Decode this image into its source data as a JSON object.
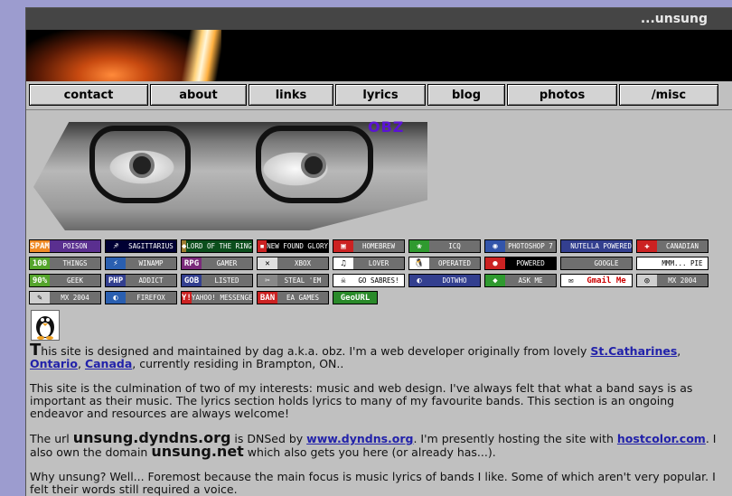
{
  "site": {
    "title": "...unsung"
  },
  "nav": [
    {
      "label": "contact",
      "w": 130
    },
    {
      "label": "about",
      "w": 105
    },
    {
      "label": "links",
      "w": 92
    },
    {
      "label": "lyrics",
      "w": 98
    },
    {
      "label": "blog",
      "w": 84
    },
    {
      "label": "photos",
      "w": 120
    },
    {
      "label": "/misc",
      "w": 108
    }
  ],
  "hero": {
    "tag": "OBZ"
  },
  "buttons": [
    {
      "icon": "SPAM",
      "text": "POISON",
      "bg": "#5a2f8f",
      "ic": "#f08a24"
    },
    {
      "icon": "♐",
      "text": "SAGITTARIUS",
      "bg": "#000033",
      "ic": "#000033"
    },
    {
      "icon": "◆",
      "text": "LORD OF THE RINGS",
      "bg": "#0b4e1c",
      "ic": "#9c7c30"
    },
    {
      "icon": "▪",
      "text": "NEW FOUND GLORY",
      "bg": "#000000",
      "ic": "#cc2222"
    },
    {
      "icon": "▣",
      "text": "HOMEBREW",
      "bg": "#6f6f6f",
      "ic": "#cc2222"
    },
    {
      "icon": "❀",
      "text": "ICQ",
      "bg": "#6f6f6f",
      "ic": "#2f9a2f"
    },
    {
      "icon": "◉",
      "text": "PHOTOSHOP 7",
      "bg": "#6f6f6f",
      "ic": "#3355aa"
    },
    {
      "icon": "",
      "text": "NUTELLA POWERED",
      "bg": "#333f8f",
      "ic": "#333f8f"
    },
    {
      "icon": "✚",
      "text": "CANADIAN",
      "bg": "#6f6f6f",
      "ic": "#cc2222"
    },
    {
      "icon": "100",
      "text": "THINGS",
      "bg": "#6f6f6f",
      "ic": "#55a52c"
    },
    {
      "icon": "⚡",
      "text": "WINAMP",
      "bg": "#6f6f6f",
      "ic": "#2a5fb0"
    },
    {
      "icon": "RPG",
      "text": "GAMER",
      "bg": "#6f6f6f",
      "ic": "#7a2a7a"
    },
    {
      "icon": "✕",
      "text": "XBOX",
      "bg": "#6f6f6f",
      "ic": "#e0e0e0"
    },
    {
      "icon": "♫",
      "text": "LOVER",
      "bg": "#6f6f6f",
      "ic": "#ffffff"
    },
    {
      "icon": "🐧",
      "text": "OPERATED",
      "bg": "#6f6f6f",
      "ic": "#ffffff"
    },
    {
      "icon": "●",
      "text": "POWERED",
      "bg": "#000000",
      "ic": "#cc2222"
    },
    {
      "icon": "",
      "text": "GOOGLE",
      "bg": "#6f6f6f",
      "ic": "#6f6f6f"
    },
    {
      "icon": "",
      "text": "MMM... PIE",
      "bg": "#ffffff",
      "ic": "#ffffff"
    },
    {
      "icon": "90%",
      "text": "GEEK",
      "bg": "#6f6f6f",
      "ic": "#55a52c"
    },
    {
      "icon": "PHP",
      "text": "ADDICT",
      "bg": "#6f6f6f",
      "ic": "#333f8f"
    },
    {
      "icon": "GOB",
      "text": "LISTED",
      "bg": "#6f6f6f",
      "ic": "#333f8f"
    },
    {
      "icon": "✂",
      "text": "STEAL 'EM",
      "bg": "#6f6f6f",
      "ic": "#888888"
    },
    {
      "icon": "☠",
      "text": "GO SABRES!",
      "bg": "#ffffff",
      "ic": "#ffffff"
    },
    {
      "icon": "◐",
      "text": "DOTWHO",
      "bg": "#333f8f",
      "ic": "#333f8f"
    },
    {
      "icon": "◆",
      "text": "ASK ME",
      "bg": "#6f6f6f",
      "ic": "#2f9a2f"
    },
    {
      "icon": "✉",
      "text": "Gmail Me",
      "bg": "#ffffff",
      "ic": "#ffffff"
    },
    {
      "icon": "◎",
      "text": "MX 2004",
      "bg": "#6f6f6f",
      "ic": "#cfcfcf"
    },
    {
      "icon": "✎",
      "text": "MX 2004",
      "bg": "#6f6f6f",
      "ic": "#cfcfcf"
    },
    {
      "icon": "◐",
      "text": "FIREFOX",
      "bg": "#6f6f6f",
      "ic": "#2a5fb0"
    },
    {
      "icon": "Y!",
      "text": "YAHOO! MESSENGER",
      "bg": "#6f6f6f",
      "ic": "#cc2222"
    },
    {
      "icon": "BAN",
      "text": "EA GAMES",
      "bg": "#6f6f6f",
      "ic": "#cc2222"
    },
    {
      "icon": "",
      "text": "GeoURL",
      "bg": "#2a8a2a",
      "ic": "#2a8a2a"
    }
  ],
  "content": {
    "p1_cap": "T",
    "p1_a": "his site is designed and maintained by dag a.k.a. obz. I'm a web developer originally from lovely ",
    "p1_link1": "St.Catharines",
    "p1_sep1": ", ",
    "p1_link2": "Ontario",
    "p1_sep2": ", ",
    "p1_link3": "Canada",
    "p1_b": ", currently residing in Brampton, ON..",
    "p2": "This site is the culmination of two of my interests: music and web design. I've always felt that what a band says is as important as their music. The lyrics section holds lyrics to many of my favourite bands. This section is an ongoing endeavor and resources are always welcome!",
    "p3_a": "The url ",
    "p3_dom1": "unsung.dyndns.org",
    "p3_b": " is DNSed by ",
    "p3_link1": "www.dyndns.org",
    "p3_c": ". I'm presently hosting the site with ",
    "p3_link2": "hostcolor.com",
    "p3_d": ". I also own the domain ",
    "p3_dom2": "unsung.net",
    "p3_e": " which also gets you here (or already has...).",
    "p4": "Why unsung? Well... Foremost because the main focus is music lyrics of bands I like. Some of which aren't very popular. I felt their words still required a voice."
  }
}
